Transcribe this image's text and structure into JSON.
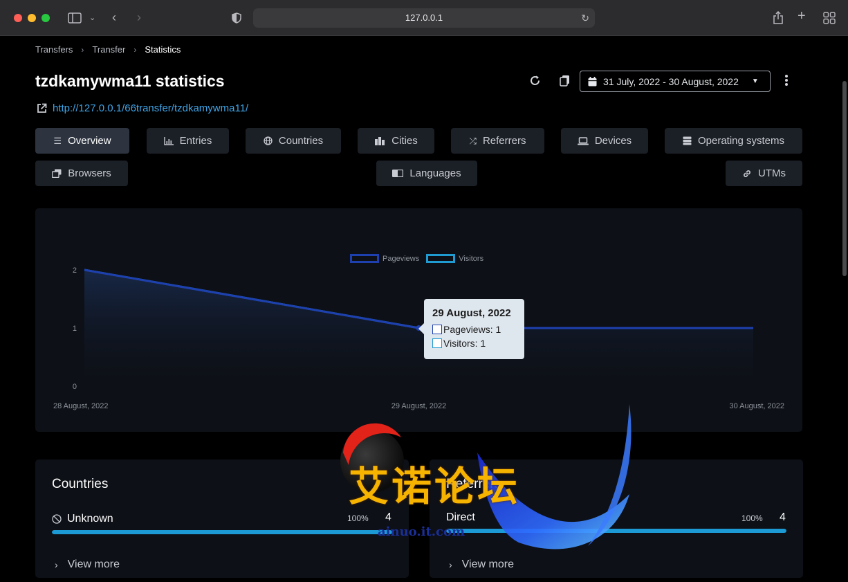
{
  "browser": {
    "url": "127.0.0.1"
  },
  "breadcrumb": {
    "items": [
      "Transfers",
      "Transfer",
      "Statistics"
    ]
  },
  "header": {
    "title": "tzdkamywma11 statistics",
    "link": "http://127.0.0.1/66transfer/tzdkamywma11/",
    "date_range": "31 July, 2022 - 30 August, 2022"
  },
  "tabs": [
    {
      "label": "Overview",
      "icon": "list-icon",
      "active": true
    },
    {
      "label": "Entries",
      "icon": "bar-chart-icon"
    },
    {
      "label": "Countries",
      "icon": "globe-icon"
    },
    {
      "label": "Cities",
      "icon": "city-icon"
    },
    {
      "label": "Referrers",
      "icon": "shuffle-icon"
    },
    {
      "label": "Devices",
      "icon": "laptop-icon"
    },
    {
      "label": "Operating systems",
      "icon": "server-icon"
    },
    {
      "label": "Browsers",
      "icon": "windows-icon"
    },
    {
      "label": "Languages",
      "icon": "language-icon"
    },
    {
      "label": "UTMs",
      "icon": "link-icon"
    }
  ],
  "chart_data": {
    "type": "line",
    "x": [
      "28 August, 2022",
      "29 August, 2022",
      "30 August, 2022"
    ],
    "series": [
      {
        "name": "Pageviews",
        "values": [
          2,
          1,
          1
        ],
        "color": "#1e40af"
      },
      {
        "name": "Visitors",
        "values": [
          2,
          1,
          1
        ],
        "color": "#1f9bd1"
      }
    ],
    "yticks": [
      "0",
      "1",
      "2"
    ],
    "ylim": [
      0,
      2
    ],
    "legend": "top-center",
    "tooltip": {
      "title": "29 August, 2022",
      "rows": [
        "Pageviews: 1",
        "Visitors: 1"
      ]
    }
  },
  "countries": {
    "title": "Countries",
    "row_label": "Unknown",
    "percent": "100%",
    "count": "4",
    "fill": 1.0,
    "more": "View more"
  },
  "referrers": {
    "title": "Referrers",
    "row_label": "Direct",
    "percent": "100%",
    "count": "4",
    "fill": 1.0,
    "more": "View more"
  },
  "watermark": {
    "text": "艾诺论坛",
    "sub": "ainuo.it.com"
  }
}
